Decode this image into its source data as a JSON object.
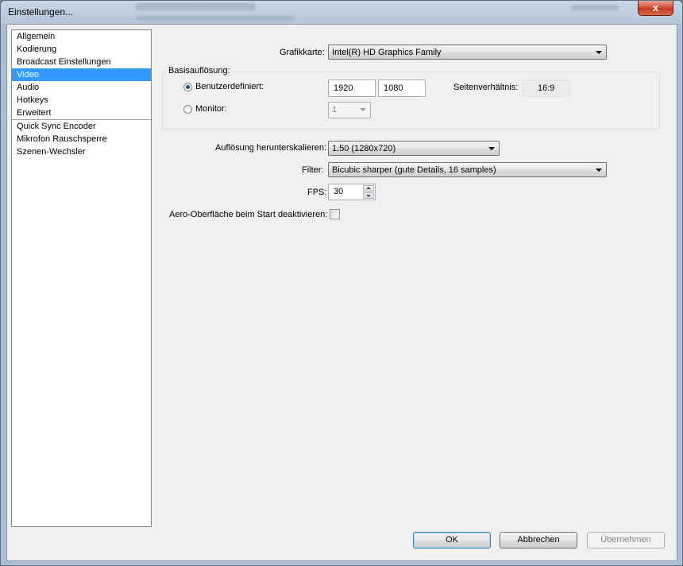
{
  "window": {
    "title": "Einstellungen...",
    "close_glyph": "x"
  },
  "sidebar": {
    "items": [
      {
        "label": "Allgemein"
      },
      {
        "label": "Kodierung"
      },
      {
        "label": "Broadcast Einstellungen"
      },
      {
        "label": "Video"
      },
      {
        "label": "Audio"
      },
      {
        "label": "Hotkeys"
      },
      {
        "label": "Erweitert"
      },
      {
        "label": "Quick Sync Encoder"
      },
      {
        "label": "Mikrofon Rauschsperre"
      },
      {
        "label": "Szenen-Wechsler"
      }
    ],
    "selected": "Video"
  },
  "video": {
    "graphics_label": "Grafikkarte:",
    "graphics_value": "Intel(R) HD Graphics Family",
    "base_group_title": "Basisauflösung:",
    "custom_label": "Benutzerdefiniert:",
    "width_value": "1920",
    "height_value": "1080",
    "aspect_label": "Seitenverhältnis:",
    "aspect_value": "16:9",
    "monitor_label": "Monitor:",
    "monitor_value": "1",
    "downscale_label": "Auflösung herunterskalieren:",
    "downscale_value": "1.50  (1280x720)",
    "filter_label": "Filter:",
    "filter_value": "Bicubic sharper (gute Details, 16 samples)",
    "fps_label": "FPS:",
    "fps_value": "30",
    "aero_label": "Aero-Oberfläche beim Start deaktivieren:"
  },
  "buttons": {
    "ok": "OK",
    "cancel": "Abbrechen",
    "apply": "Übernehmen"
  },
  "colors": {
    "selection": "#3399ff",
    "radio_dot": "#1c5180",
    "close_button": "#c23a1e"
  }
}
